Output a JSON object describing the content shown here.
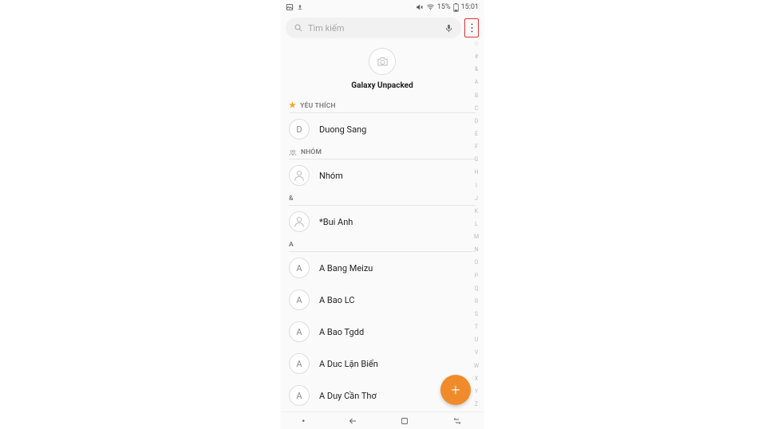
{
  "statusbar": {
    "battery_pct": "15%",
    "time": "15:01"
  },
  "search": {
    "placeholder": "Tìm kiếm"
  },
  "profile": {
    "title": "Galaxy Unpacked"
  },
  "sections": {
    "favorites_label": "YÊU THÍCH",
    "groups_label": "NHÓM",
    "amp_label": "&",
    "a_label": "A"
  },
  "contacts": {
    "fav1_initial": "D",
    "fav1_name": "Duong Sang",
    "grp1_name": "Nhóm",
    "amp1_name": "*Bui Anh",
    "a1_initial": "A",
    "a1_name": "A Bang Meizu",
    "a2_initial": "A",
    "a2_name": "A Bao LC",
    "a3_initial": "A",
    "a3_name": "A Bao Tgdd",
    "a4_initial": "A",
    "a4_name": "A Duc Lặn Biển",
    "a5_initial": "A",
    "a5_name": "A Duy Cần Thơ"
  },
  "alpha_index": [
    "☆",
    "#",
    "&",
    "A",
    "B",
    "C",
    "D",
    "E",
    "F",
    "G",
    "H",
    "I",
    "J",
    "K",
    "L",
    "M",
    "N",
    "O",
    "P",
    "Q",
    "R",
    "S",
    "T",
    "U",
    "V",
    "W",
    "X",
    "Y",
    "Z"
  ],
  "fab": {
    "label": "+"
  }
}
